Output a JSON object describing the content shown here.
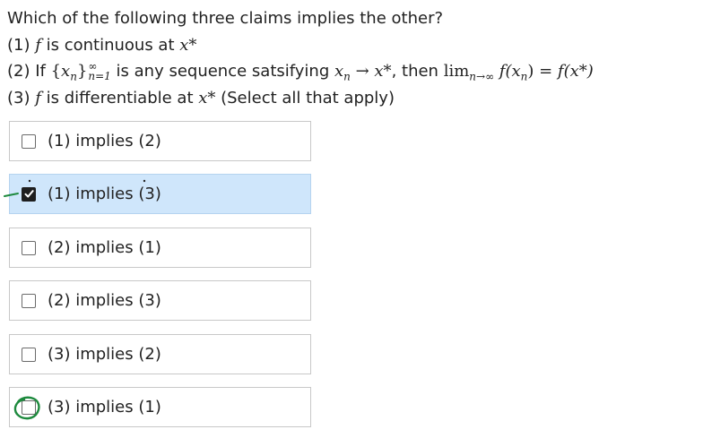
{
  "question": {
    "line1": "Which of the following three claims implies the other?",
    "line2_prefix": "(1) ",
    "line2_var": "f",
    "line2_mid": " is continuous at ",
    "line2_point": "x*",
    "line3_prefix": "(2) If ",
    "line3_seq": "{x",
    "line3_seq_sub": "n",
    "line3_seq_close": "}",
    "line3_sup": "∞",
    "line3_sub": "n=1",
    "line3_mid": " is any sequence satsifying ",
    "line3_conv": "x",
    "line3_conv_sub": "n",
    "line3_arrow": " → ",
    "line3_target": "x*",
    "line3_then": ", then ",
    "line3_lim": "lim",
    "line3_lim_sub": "n→∞",
    "line3_lhs": " f(x",
    "line3_lhs_sub": "n",
    "line3_lhs_close": ")",
    "line3_eq": " = ",
    "line3_rhs": "f(x*)",
    "line4_prefix": "(3) ",
    "line4_var": "f",
    "line4_mid": " is differentiable at ",
    "line4_point": "x*",
    "line4_suffix": " (Select all that apply)"
  },
  "options": [
    {
      "label": "(1) implies (2)",
      "checked": false
    },
    {
      "label": "(1) implies (3)",
      "checked": true
    },
    {
      "label": "(2) implies (1)",
      "checked": false
    },
    {
      "label": "(2) implies (3)",
      "checked": false
    },
    {
      "label": "(3) implies (2)",
      "checked": false
    },
    {
      "label": "(3) implies (1)",
      "checked": false
    }
  ],
  "colors": {
    "selected_bg": "#cfe6fb",
    "border": "#c8c8c8",
    "annotation": "#1e8a3e"
  }
}
